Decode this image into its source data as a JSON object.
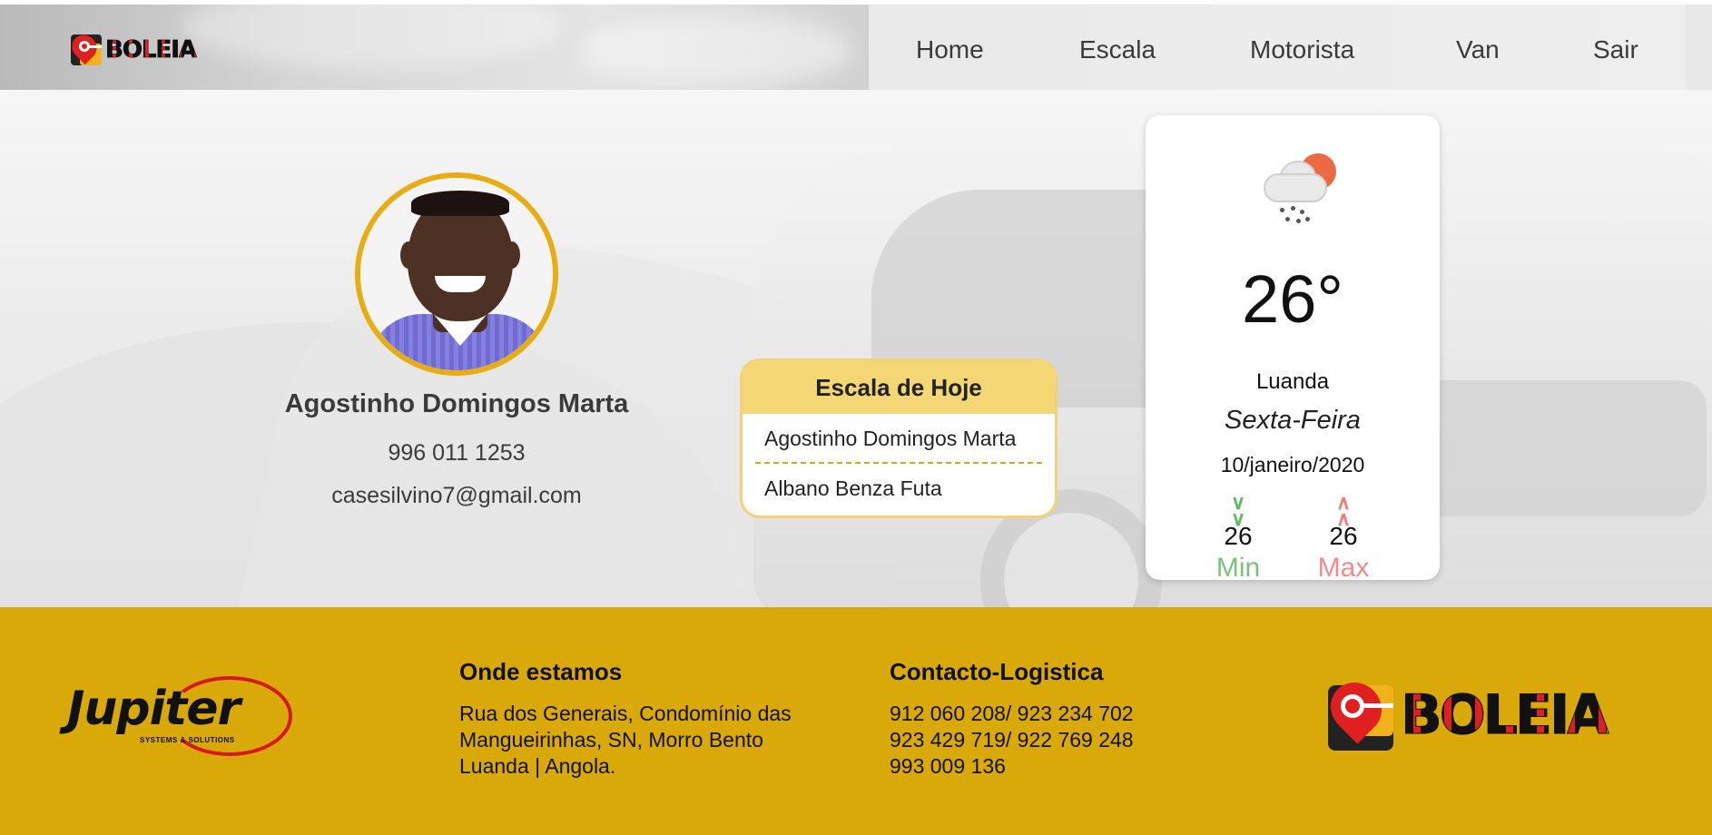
{
  "header": {
    "logo_text": "BOLEIA",
    "nav": [
      {
        "label": "Home"
      },
      {
        "label": "Escala"
      },
      {
        "label": "Motorista"
      },
      {
        "label": "Van"
      },
      {
        "label": "Sair"
      }
    ]
  },
  "profile": {
    "name": "Agostinho Domingos Marta",
    "phone": "996 011 1253",
    "email": "casesilvino7@gmail.com"
  },
  "escala": {
    "title": "Escala de Hoje",
    "items": [
      "Agostinho Domingos Marta",
      "Albano Benza Futa"
    ]
  },
  "weather": {
    "icon": "cloud-rain-sun-icon",
    "temperature": "26°",
    "city": "Luanda",
    "weekday": "Sexta-Feira",
    "date": "10/janeiro/2020",
    "min_value": "26",
    "min_label": "Min",
    "max_value": "26",
    "max_label": "Max",
    "min_color": "#79c37a",
    "max_color": "#f28c8c"
  },
  "footer": {
    "partner_logo": "Jupiter",
    "partner_tagline": "SYSTEMS & SOLUTIONS",
    "location": {
      "title": "Onde estamos",
      "lines": [
        "Rua dos Generais, Condomínio das",
        "Mangueirinhas, SN, Morro Bento",
        "Luanda | Angola."
      ]
    },
    "contact": {
      "title": "Contacto-Logistica",
      "lines": [
        "912 060 208/ 923 234 702",
        "923 429 719/ 922 769 248",
        "993 009 136"
      ]
    },
    "brand_logo": "BOLEIA"
  },
  "colors": {
    "accent_yellow": "#d9a809",
    "avatar_border": "#e6ad14",
    "brand_red": "#e02020"
  }
}
